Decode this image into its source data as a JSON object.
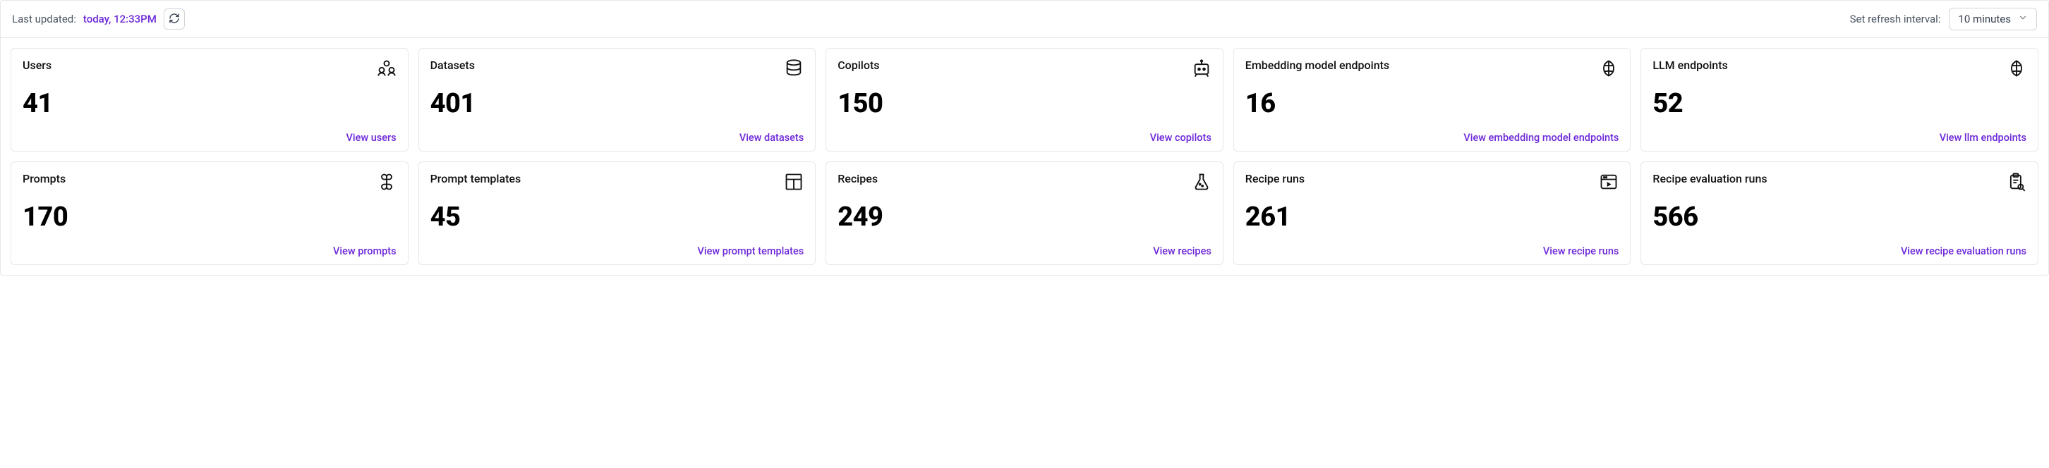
{
  "header": {
    "last_updated_label": "Last updated:",
    "last_updated_value": "today, 12:33PM",
    "refresh_interval_label": "Set refresh interval:",
    "refresh_interval_value": "10 minutes"
  },
  "cards": {
    "users": {
      "title": "Users",
      "value": "41",
      "link": "View users"
    },
    "datasets": {
      "title": "Datasets",
      "value": "401",
      "link": "View datasets"
    },
    "copilots": {
      "title": "Copilots",
      "value": "150",
      "link": "View copilots"
    },
    "embedding_endpoints": {
      "title": "Embedding model endpoints",
      "value": "16",
      "link": "View embedding model endpoints"
    },
    "llm_endpoints": {
      "title": "LLM endpoints",
      "value": "52",
      "link": "View llm endpoints"
    },
    "prompts": {
      "title": "Prompts",
      "value": "170",
      "link": "View prompts"
    },
    "prompt_templates": {
      "title": "Prompt templates",
      "value": "45",
      "link": "View prompt templates"
    },
    "recipes": {
      "title": "Recipes",
      "value": "249",
      "link": "View recipes"
    },
    "recipe_runs": {
      "title": "Recipe runs",
      "value": "261",
      "link": "View recipe runs"
    },
    "recipe_evaluation_runs": {
      "title": "Recipe evaluation runs",
      "value": "566",
      "link": "View recipe evaluation runs"
    }
  }
}
